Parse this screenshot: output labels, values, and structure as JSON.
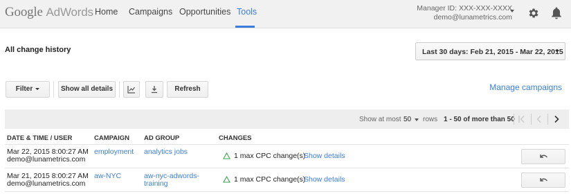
{
  "header": {
    "logo_google": "Google",
    "logo_product": "AdWords",
    "nav": [
      {
        "label": "Home"
      },
      {
        "label": "Campaigns"
      },
      {
        "label": "Opportunities"
      },
      {
        "label": "Tools",
        "active": true
      }
    ],
    "manager_id": "Manager ID: XXX-XXX-XXXX",
    "account_email": "demo@lunametrics.com",
    "icons": [
      "chevron-down-icon",
      "gear-icon",
      "bell-icon"
    ]
  },
  "page": {
    "title": "All change history",
    "date_range": "Last 30 days: Feb 21, 2015 - Mar 22, 2015"
  },
  "toolbar": {
    "filter_label": "Filter",
    "show_all_details_label": "Show all details",
    "chart_icon": "line-chart-icon",
    "download_icon": "download-icon",
    "refresh_label": "Refresh",
    "manage_campaigns_label": "Manage campaigns"
  },
  "pager": {
    "show_at_most_label": "Show at most",
    "page_size": "50",
    "rows_label": "rows",
    "range_label": "1 - 50 of more than 50"
  },
  "table": {
    "columns": [
      "DATE & TIME / USER",
      "CAMPAIGN",
      "AD GROUP",
      "CHANGES"
    ],
    "rows": [
      {
        "datetime": "Mar 22, 2015 8:00:27 AM",
        "user": "demo@lunametrics.com",
        "campaign": "employment",
        "ad_group_line1": "analytics jobs",
        "ad_group_line2": "",
        "change": "1 max CPC change(s)",
        "details_link": "Show details"
      },
      {
        "datetime": "Mar 21, 2015 8:00:27 AM",
        "user": "demo@lunametrics.com",
        "campaign": "aw-NYC",
        "ad_group_line1": "aw-nyc-adwords-",
        "ad_group_line2": "training",
        "change": "1 max CPC change(s)",
        "details_link": "Show details"
      }
    ]
  },
  "colors": {
    "accent": "#3b7ddd",
    "change_triangle": "#3fa34d"
  }
}
